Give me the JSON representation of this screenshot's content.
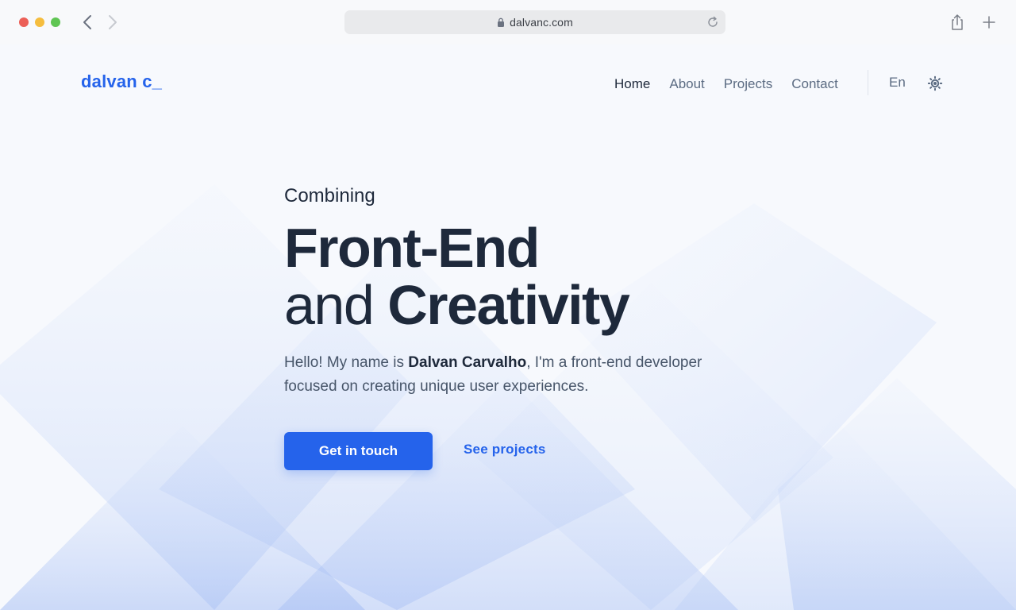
{
  "browser": {
    "url": "dalvanc.com"
  },
  "site": {
    "logo": "dalvan c_",
    "nav": {
      "items": [
        "Home",
        "About",
        "Projects",
        "Contact"
      ],
      "active": "Home"
    },
    "language": "En"
  },
  "hero": {
    "kicker": "Combining",
    "headline_line1": "Front-End",
    "headline_line2_light": "and",
    "headline_line2_strong": "Creativity",
    "intro_before": "Hello! My name is ",
    "intro_name": "Dalvan Carvalho",
    "intro_after": ", I'm a front-end developer focused on creating unique user experiences.",
    "primary_cta": "Get in touch",
    "secondary_cta": "See projects"
  },
  "colors": {
    "accent": "#2563eb",
    "text_dark": "#1e293b",
    "text_muted": "#5b6b82",
    "page_bg": "#f7f9fd"
  }
}
